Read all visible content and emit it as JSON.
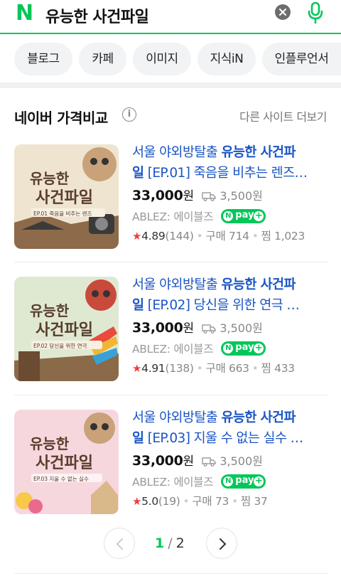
{
  "search": {
    "logo": "N",
    "query": "유능한 사건파일"
  },
  "tabs": [
    "블로그",
    "카페",
    "이미지",
    "지식iN",
    "인플루언서"
  ],
  "section": {
    "title": "네이버 가격비교",
    "info": "i",
    "more": "다른 사이트 더보기"
  },
  "products": [
    {
      "title_prefix": "서울 야외방탈출 ",
      "title_bold": "유능한 사건파",
      "title_line2_bold": "일",
      "title_rest": " [EP.01] 죽음을 비추는 렌즈…",
      "price": "33,000",
      "won": "원",
      "shipping": "3,500원",
      "seller": "ABLEZ: 에이블즈",
      "npay": "pay",
      "rating": "4.89",
      "reviews": "(144)",
      "purchases": "구매 714",
      "likes": "찜 1,023",
      "thumb_title1": "유능한",
      "thumb_title2": "사건파일",
      "thumb_ep": "EP.01 죽음을 비추는 렌즈",
      "thumb_bg": "#efe4cf"
    },
    {
      "title_prefix": "서울 야외방탈출 ",
      "title_bold": "유능한 사건파",
      "title_line2_bold": "일",
      "title_rest": " [EP.02] 당신을 위한 연극 …",
      "price": "33,000",
      "won": "원",
      "shipping": "3,500원",
      "seller": "ABLEZ: 에이블즈",
      "npay": "pay",
      "rating": "4.91",
      "reviews": "(138)",
      "purchases": "구매 663",
      "likes": "찜 433",
      "thumb_title1": "유능한",
      "thumb_title2": "사건파일",
      "thumb_ep": "EP.02 당신을 위한 연극",
      "thumb_bg": "#dfe9d2"
    },
    {
      "title_prefix": "서울 야외방탈출 ",
      "title_bold": "유능한 사건파",
      "title_line2_bold": "일",
      "title_rest": " [EP.03] 지울 수 없는 실수 …",
      "price": "33,000",
      "won": "원",
      "shipping": "3,500원",
      "seller": "ABLEZ: 에이블즈",
      "npay": "pay",
      "rating": "5.0",
      "reviews": "(19)",
      "purchases": "구매 73",
      "likes": "찜 37",
      "thumb_title1": "유능한",
      "thumb_title2": "사건파일",
      "thumb_ep": "EP.03 지울 수 없는 실수",
      "thumb_bg": "#f6d7de"
    }
  ],
  "pagination": {
    "current": "1",
    "separator": "/",
    "total": "2"
  },
  "colors": {
    "naver_green": "#03c75a",
    "link_blue": "#1a55c5",
    "star_red": "#f53b3b"
  },
  "icons": {
    "clear": "close-circle-icon",
    "mic": "microphone-icon",
    "ship": "truck-icon",
    "prev": "chevron-left-icon",
    "next": "chevron-right-icon"
  }
}
